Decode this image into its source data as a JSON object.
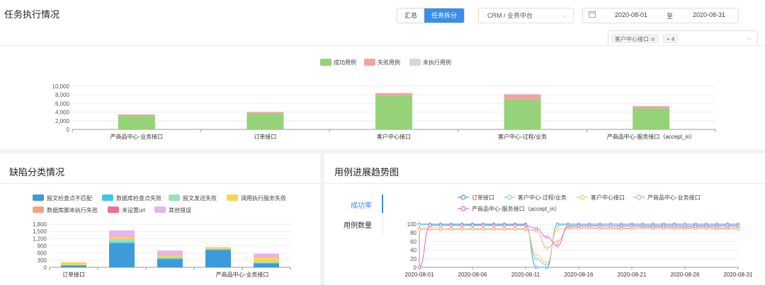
{
  "header": {
    "title": "任务执行情况",
    "view_tabs": [
      "汇总",
      "任务拆分"
    ],
    "active_view": "任务拆分",
    "system_select": "CRM / 业务中台",
    "date_start": "2020-08-01",
    "date_sep": "至",
    "date_end": "2020-08-31",
    "interface_tag": "客户中心接口",
    "more_count": "+ 4"
  },
  "colors": {
    "primary": "#3a8ee6",
    "success": "#96d277",
    "fail": "#f5a29f",
    "not_run": "#d3d6db"
  },
  "left_panel": {
    "title": "缺陷分类情况"
  },
  "right_panel": {
    "title": "用例进展趋势图",
    "tabs": [
      "成功率",
      "用例数量"
    ],
    "active_tab": "成功率"
  },
  "chart_data": [
    {
      "type": "bar",
      "stacked": true,
      "legend_position": "top-center",
      "categories": [
        "产商品中心-业务接口",
        "订单接口",
        "客户中心接口",
        "客户中心-过程/业务",
        "产商品中心-服务接口（accept_in）"
      ],
      "series": [
        {
          "name": "成功用例",
          "color": "#96d277",
          "values": [
            3100,
            3800,
            7900,
            6900,
            4900
          ]
        },
        {
          "name": "失败用例",
          "color": "#f5a29f",
          "values": [
            350,
            250,
            500,
            1200,
            450
          ]
        },
        {
          "name": "未执行用例",
          "color": "#d3d6db",
          "values": [
            80,
            50,
            100,
            100,
            100
          ]
        }
      ],
      "y_ticks": [
        "0",
        "2,000",
        "4,000",
        "6,000",
        "8,000",
        "10,000"
      ],
      "ylim": [
        0,
        10000
      ],
      "grid": true
    },
    {
      "type": "bar",
      "stacked": true,
      "legend_position": "top",
      "categories": [
        "订单接口",
        "",
        "",
        "产商品中心-业务接口",
        ""
      ],
      "series": [
        {
          "name": "报文检查点不匹配",
          "color": "#3e9bd9",
          "values": [
            80,
            1000,
            350,
            720,
            170
          ]
        },
        {
          "name": "数据库检查点失败",
          "color": "#3ec6e8",
          "values": [
            10,
            50,
            20,
            30,
            10
          ]
        },
        {
          "name": "报文发送失败",
          "color": "#9de0b8",
          "values": [
            20,
            130,
            60,
            20,
            60
          ]
        },
        {
          "name": "调用执行服务失败",
          "color": "#fad44f",
          "values": [
            100,
            80,
            80,
            60,
            180
          ]
        },
        {
          "name": "数据库脚本执行失败",
          "color": "#f6a27f",
          "values": [
            5,
            20,
            20,
            10,
            20
          ]
        },
        {
          "name": "未设置url",
          "color": "#ef6f8a",
          "values": [
            0,
            10,
            10,
            0,
            10
          ]
        },
        {
          "name": "其他错误",
          "color": "#e6b3f3",
          "values": [
            0,
            250,
            160,
            0,
            120
          ]
        }
      ],
      "y_ticks": [
        "0",
        "300",
        "600",
        "900",
        "1,200",
        "1,500",
        "1,800"
      ],
      "ylim": [
        0,
        1800
      ],
      "grid": true
    },
    {
      "type": "line",
      "legend_position": "top",
      "x_ticks": [
        "2020-08-01",
        "2020-08-06",
        "2020-08-11",
        "2020-08-16",
        "2020-08-21",
        "2020-08-26",
        "2020-08-31"
      ],
      "y_ticks": [
        "0",
        "20",
        "40",
        "60",
        "80",
        "100"
      ],
      "ylim": [
        0,
        100
      ],
      "xlim": [
        1,
        31
      ],
      "grid": true,
      "series": [
        {
          "name": "订单接口",
          "color": "#3e9bd9",
          "x": [
            1,
            2,
            3,
            4,
            5,
            6,
            7,
            8,
            9,
            10,
            11,
            12,
            13,
            14,
            15,
            16,
            17,
            18,
            19,
            20,
            21,
            22,
            23,
            24,
            25,
            26,
            27,
            28,
            29,
            30,
            31
          ],
          "values": [
            100,
            100,
            100,
            100,
            100,
            100,
            100,
            100,
            100,
            100,
            100,
            0,
            0,
            100,
            100,
            100,
            100,
            100,
            100,
            100,
            100,
            100,
            100,
            100,
            100,
            100,
            100,
            100,
            100,
            100,
            100
          ]
        },
        {
          "name": "客户中心-过程/业务",
          "color": "#6fd3e8",
          "x": [
            1,
            2,
            3,
            4,
            5,
            6,
            7,
            8,
            9,
            10,
            11,
            12,
            13,
            14,
            15,
            16,
            17,
            18,
            19,
            20,
            21,
            22,
            23,
            24,
            25,
            26,
            27,
            28,
            29,
            30,
            31
          ],
          "values": [
            99,
            99,
            99,
            99,
            99,
            98,
            99,
            98,
            98,
            98,
            98,
            20,
            5,
            97,
            97,
            97,
            97,
            97,
            96,
            97,
            97,
            97,
            97,
            97,
            98,
            97,
            97,
            97,
            97,
            98,
            97
          ]
        },
        {
          "name": "客户中心接口",
          "color": "#f8c865",
          "x": [
            1,
            2,
            3,
            4,
            5,
            6,
            7,
            8,
            9,
            10,
            11,
            12,
            13,
            14,
            15,
            16,
            17,
            18,
            19,
            20,
            21,
            22,
            23,
            24,
            25,
            26,
            27,
            28,
            29,
            30,
            31
          ],
          "values": [
            90,
            92,
            91,
            90,
            91,
            90,
            90,
            90,
            90,
            90,
            90,
            30,
            10,
            88,
            92,
            93,
            92,
            91,
            92,
            91,
            91,
            92,
            92,
            93,
            92,
            92,
            92,
            93,
            91,
            91,
            92
          ]
        },
        {
          "name": "产商品中心-业务接口",
          "color": "#f3a58a",
          "x": [
            1,
            2,
            3,
            4,
            5,
            6,
            7,
            8,
            9,
            10,
            11,
            12,
            13,
            14,
            15,
            16,
            17,
            18,
            19,
            20,
            21,
            22,
            23,
            24,
            25,
            26,
            27,
            28,
            29,
            30,
            31
          ],
          "values": [
            88,
            88,
            87,
            88,
            88,
            88,
            88,
            88,
            88,
            88,
            88,
            85,
            45,
            60,
            90,
            90,
            91,
            90,
            90,
            89,
            90,
            91,
            90,
            90,
            90,
            90,
            90,
            90,
            89,
            89,
            89
          ]
        },
        {
          "name": "产商品中心-服务接口（accept_in）",
          "color": "#d966cc",
          "x": [
            1,
            2,
            3,
            4,
            5,
            6,
            7,
            8,
            9,
            10,
            11,
            12,
            13,
            14,
            15,
            16,
            17,
            18,
            19,
            20,
            21,
            22,
            23,
            24,
            25,
            26,
            27,
            28,
            29,
            30,
            31
          ],
          "values": [
            0,
            97,
            97,
            97,
            97,
            97,
            97,
            97,
            97,
            97,
            97,
            90,
            70,
            50,
            95,
            96,
            96,
            96,
            96,
            95,
            96,
            95,
            95,
            95,
            95,
            94,
            95,
            95,
            95,
            95,
            95
          ]
        }
      ]
    }
  ]
}
